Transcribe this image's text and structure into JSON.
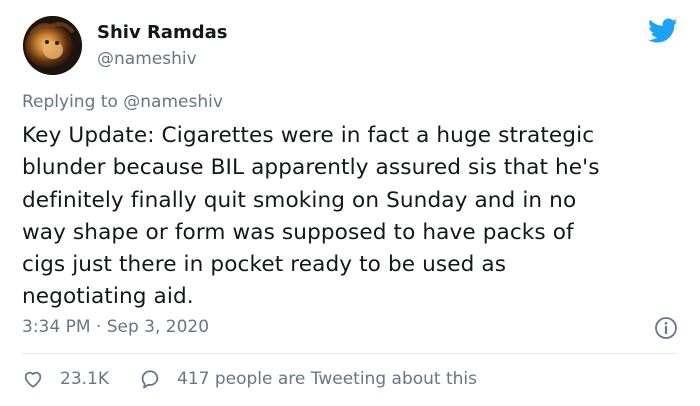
{
  "author": {
    "display_name": "Shiv Ramdas",
    "handle": "@nameshiv"
  },
  "reply": {
    "prefix": "Replying to",
    "mention": "@nameshiv"
  },
  "tweet": {
    "lines": [
      "Key Update: Cigarettes were in fact a huge strategic",
      "blunder because BIL apparently assured sis that he's",
      "definitely finally quit smoking on Sunday and in no",
      "way shape or form was supposed to have packs of",
      "cigs just there in pocket ready to be used as",
      "negotiating aid."
    ]
  },
  "meta": {
    "time": "3:34 PM",
    "separator": "·",
    "date": "Sep 3, 2020"
  },
  "actions": {
    "likes": "23.1K",
    "discussion": "417 people are Tweeting about this"
  },
  "icons": {
    "brand": "twitter-bird-icon",
    "info": "info-icon",
    "like": "heart-icon",
    "comment": "comment-bubble-icon"
  },
  "colors": {
    "brand": "#1da1f2",
    "muted": "#657786",
    "text": "#14171a",
    "divider": "#e1e8ed"
  }
}
